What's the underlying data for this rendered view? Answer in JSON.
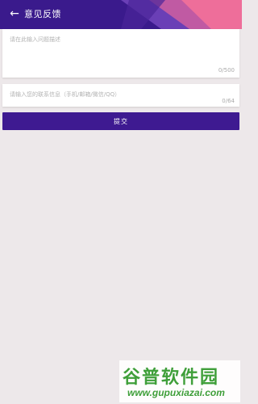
{
  "header": {
    "title": "意见反馈",
    "back_icon": "arrow-left-icon",
    "colors": {
      "primary": "#3e1a91",
      "accent_pink": "#e7649a"
    }
  },
  "feedback": {
    "description_placeholder": "请在此输入问题描述",
    "description_counter": "0/500",
    "contact_placeholder": "请输入您的联系信息（手机/邮箱/微信/QQ）",
    "contact_counter": "0/64",
    "submit_label": "提交"
  },
  "watermark": {
    "brand": "谷普软件园",
    "url": "www.gupuxiazai.com"
  }
}
